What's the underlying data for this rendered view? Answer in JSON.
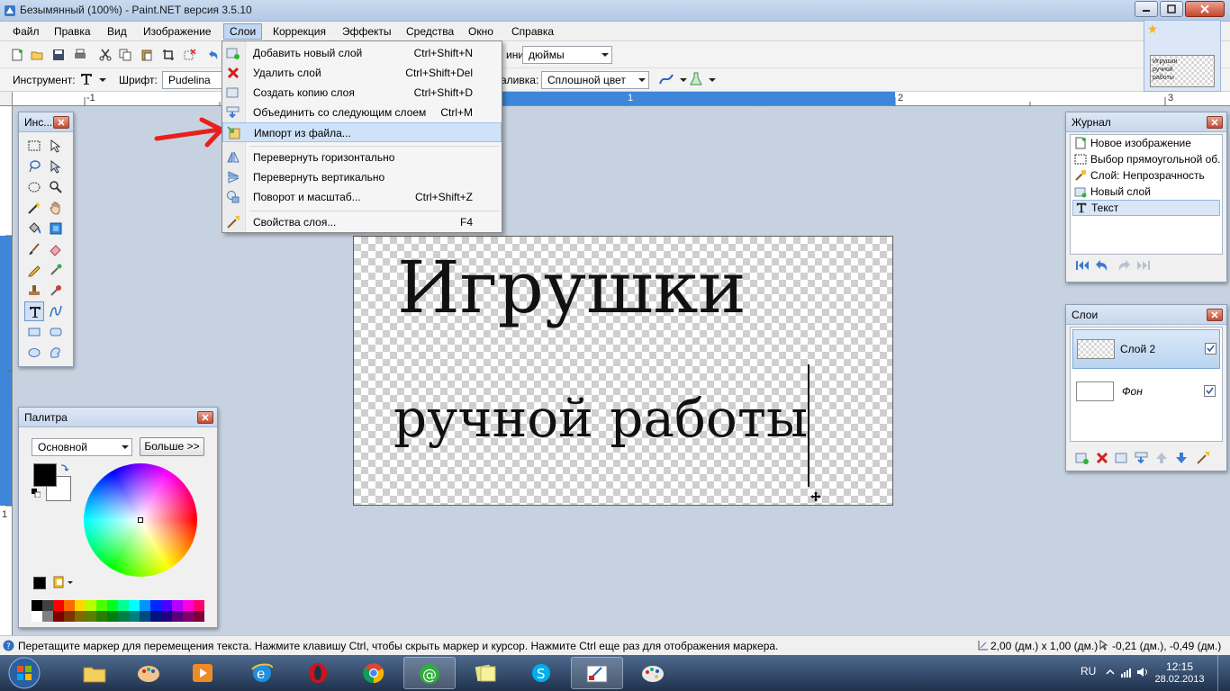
{
  "window": {
    "title": "Безымянный (100%) - Paint.NET версия 3.5.10"
  },
  "menubar": {
    "items": [
      "Файл",
      "Правка",
      "Вид",
      "Изображение",
      "Слои",
      "Коррекция",
      "Эффекты",
      "Средства",
      "Окно",
      "Справка"
    ],
    "active": "Слои"
  },
  "toolbar": {
    "units_label_partial": "иния:",
    "units_value": "дюймы",
    "tool_label": "Инструмент:",
    "font_label": "Шрифт:",
    "font_value": "Pudelina",
    "fill_label_partial": "аливка:",
    "fill_value": "Сплошной цвет"
  },
  "ruler": {
    "h": [
      "-1",
      "1",
      "2",
      "3"
    ],
    "v": [
      "1"
    ]
  },
  "layers_menu": {
    "items": [
      {
        "label": "Добавить новый слой",
        "shortcut": "Ctrl+Shift+N",
        "icon": "add-layer-icon"
      },
      {
        "label": "Удалить слой",
        "shortcut": "Ctrl+Shift+Del",
        "icon": "delete-layer-icon"
      },
      {
        "label": "Создать копию слоя",
        "shortcut": "Ctrl+Shift+D",
        "icon": "duplicate-layer-icon"
      },
      {
        "label": "Объединить со следующим слоем",
        "shortcut": "Ctrl+M",
        "icon": "merge-down-icon"
      },
      {
        "label": "Импорт из файла...",
        "shortcut": "",
        "icon": "import-file-icon"
      },
      {
        "label": "Перевернуть горизонтально",
        "shortcut": "",
        "icon": "flip-horizontal-icon"
      },
      {
        "label": "Перевернуть вертикально",
        "shortcut": "",
        "icon": "flip-vertical-icon"
      },
      {
        "label": "Поворот и масштаб...",
        "shortcut": "Ctrl+Shift+Z",
        "icon": "rotate-zoom-icon"
      },
      {
        "label": "Свойства слоя...",
        "shortcut": "F4",
        "icon": "layer-properties-icon"
      }
    ]
  },
  "tools_panel": {
    "title": "Инс..."
  },
  "palette_panel": {
    "title": "Палитра",
    "mode": "Основной",
    "more_button": "Больше >>"
  },
  "history_panel": {
    "title": "Журнал",
    "items": [
      "Новое изображение",
      "Выбор прямоугольной об...",
      "Слой: Непрозрачность",
      "Новый слой",
      "Текст"
    ],
    "selected": "Текст"
  },
  "layers_panel": {
    "title": "Слои",
    "layers": [
      {
        "name": "Слой 2",
        "visible": true,
        "selected": true
      },
      {
        "name": "Фон",
        "visible": true,
        "selected": false
      }
    ]
  },
  "canvas": {
    "line1": "Игрушки",
    "line2": "ручной работы"
  },
  "thumbnail": {
    "preview_text": "Игрушки ручной работы"
  },
  "statusbar": {
    "hint": "Перетащите маркер для перемещения текста. Нажмите клавишу Ctrl, чтобы скрыть маркер и курсор. Нажмите Ctrl еще раз для отображения маркера.",
    "size": "2,00 (дм.) x 1,00 (дм.)",
    "position": "-0,21 (дм.), -0,49 (дм.)"
  },
  "taskbar": {
    "lang": "RU",
    "time": "12:15",
    "date": "28.02.2013"
  },
  "colors": {
    "accent": "#c2d8f2",
    "menu_hover": "#cfe2f7",
    "annotation_arrow": "#e8201c"
  }
}
